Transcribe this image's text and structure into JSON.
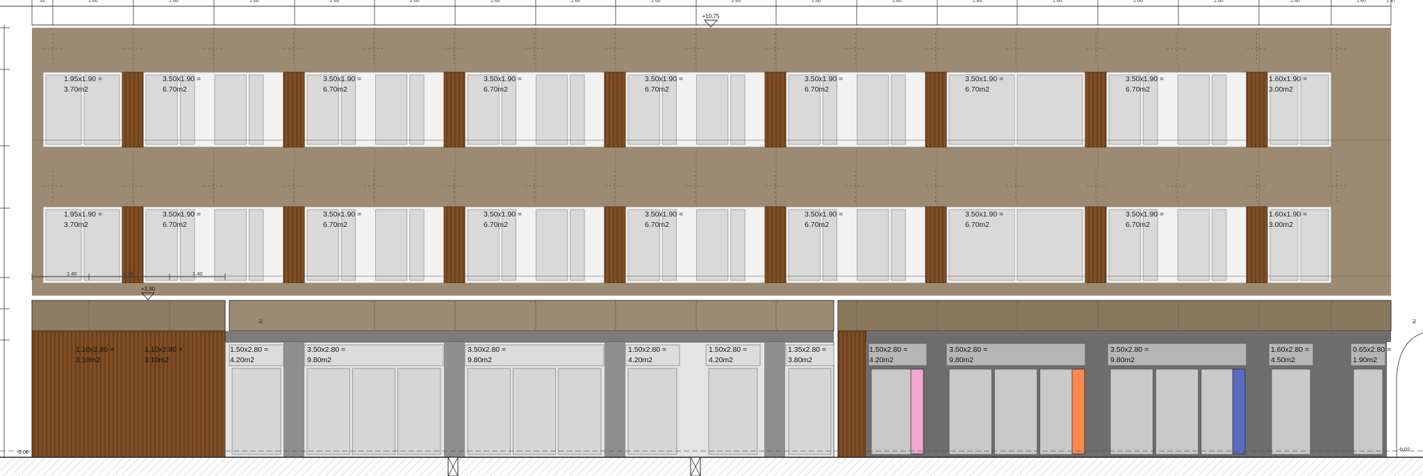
{
  "colors": {
    "background": "#ffffff",
    "facade_brown": "#9c8b72",
    "facade_brown_dark": "#8c7a60",
    "glazing": "#d9d9d9",
    "glazing_frame": "#f2f2f2",
    "timber": "#7a4a22",
    "timber_stripe": "#5e3614",
    "shop_pier": "#8f8f8f",
    "shop_pier_dark": "#6e6e6e",
    "shop_glass": "#c9c9c9",
    "shop_glass_dark": "#b5b5b5",
    "accent_pink": "#f2a6d0",
    "accent_orange": "#ff8850",
    "accent_blue": "#5a6bbf",
    "line": "#333333"
  },
  "dimension_ticks": [
    "32",
    "2.60",
    "2.60",
    "2.60",
    "2.60",
    "2.60",
    "2.60",
    "2.60",
    "2.60",
    "2.60",
    "2.60",
    "2.60",
    "2.60",
    "2.60",
    "2.60",
    "2.60",
    "2.60",
    "1.40",
    "1.47"
  ],
  "levels": {
    "roof": "+10.75",
    "first_floor": "+3.90",
    "ground_left": "-0.06",
    "ground_right": "-0.02"
  },
  "facade_dims": {
    "left_a": "1.40",
    "left_b": "3.00",
    "left_c": "1.40",
    "canopy_height": "78",
    "canopy_height_right": "78"
  },
  "upper_floor_windows": [
    [
      "1.95x1.90 =",
      "3.70m2"
    ],
    [
      "3.50x1.90 =",
      "6.70m2"
    ],
    [
      "3.50x1.90 =",
      "6.70m2"
    ],
    [
      "3.50x1.90 =",
      "6.70m2"
    ],
    [
      "3.50x1.90 =",
      "6.70m2"
    ],
    [
      "3.50x1.90 =",
      "6.70m2"
    ],
    [
      "3.50x1.90 =",
      "6.70m2"
    ],
    [
      "3.50x1.90 =",
      "6.70m2"
    ],
    [
      "1.60x1.90 =",
      "3.00m2"
    ]
  ],
  "ground_floor_openings": [
    [
      "1.10x2.80 =",
      "3.10m2"
    ],
    [
      "1.10x2.80 =",
      "3.10m2"
    ],
    [
      "1.50x2.80 =",
      "4.20m2"
    ],
    [
      "3.50x2.80 =",
      "9.80m2"
    ],
    [
      "3.50x2.80 =",
      "9.80m2"
    ],
    [
      "1.50x2.80 =",
      "4.20m2"
    ],
    [
      "1.50x2.80 =",
      "4.20m2"
    ],
    [
      "1.35x2.80 =",
      "3.80m2"
    ],
    [
      "1.50x2.80 =",
      "4.20m2"
    ],
    [
      "3.50x2.80 =",
      "9.80m2"
    ],
    [
      "3.50x2.80 =",
      "9.80m2"
    ],
    [
      "1.60x2.80 =",
      "4.50m2"
    ],
    [
      "0.65x2.80 =",
      "1.90m2"
    ]
  ]
}
